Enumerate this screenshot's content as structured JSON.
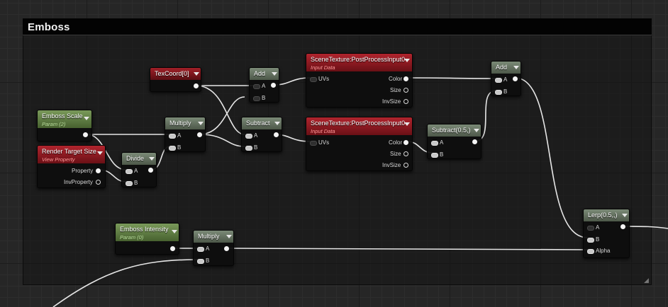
{
  "comment": {
    "title": "Emboss"
  },
  "nodes": {
    "texcoord": {
      "title": "TexCoord[0]"
    },
    "add1": {
      "title": "Add",
      "inputs": [
        "A",
        "B"
      ]
    },
    "scene1": {
      "title": "SceneTexture:PostProcessInput0",
      "subtitle": "Input Data",
      "inputs": [
        "UVs"
      ],
      "outputs": [
        "Color",
        "Size",
        "InvSize"
      ]
    },
    "add2": {
      "title": "Add",
      "inputs": [
        "A",
        "B"
      ]
    },
    "emboss_scale": {
      "title": "Emboss Scale",
      "subtitle": "Param (2)"
    },
    "multiply1": {
      "title": "Multiply",
      "inputs": [
        "A",
        "B"
      ]
    },
    "subtract1": {
      "title": "Subtract",
      "inputs": [
        "A",
        "B"
      ]
    },
    "scene2": {
      "title": "SceneTexture:PostProcessInput0",
      "subtitle": "Input Data",
      "inputs": [
        "UVs"
      ],
      "outputs": [
        "Color",
        "Size",
        "InvSize"
      ]
    },
    "subtract2": {
      "title": "Subtract(0.5,)",
      "inputs": [
        "A",
        "B"
      ]
    },
    "render_target": {
      "title": "Render Target Size",
      "subtitle": "View Property",
      "outputs": [
        "Property",
        "InvProperty"
      ]
    },
    "divide": {
      "title": "Divide",
      "inputs": [
        "A",
        "B"
      ]
    },
    "emboss_intensity": {
      "title": "Emboss Intensity",
      "subtitle": "Param (0)"
    },
    "multiply2": {
      "title": "Multiply",
      "inputs": [
        "A",
        "B"
      ]
    },
    "lerp": {
      "title": "Lerp(0.5,,)",
      "inputs": [
        "A",
        "B",
        "Alpha"
      ]
    }
  },
  "colors": {
    "param_header": "#5e7d43",
    "operator_header": "#5e6b59",
    "scene_texture_header": "#8f1a22",
    "wire": "#e6e6e6"
  }
}
